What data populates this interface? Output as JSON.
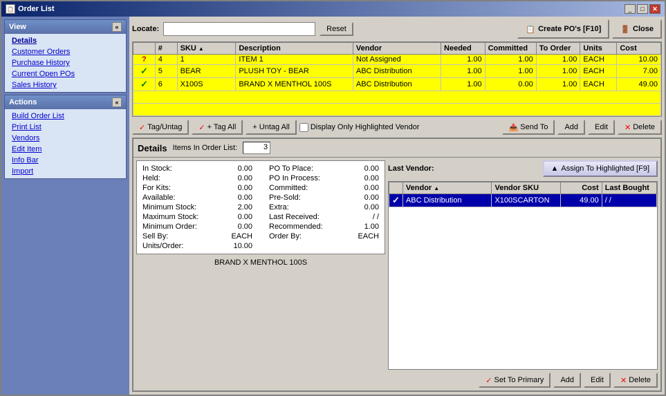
{
  "window": {
    "title": "Order List"
  },
  "locate": {
    "label": "Locate:",
    "placeholder": "",
    "reset_btn": "Reset"
  },
  "toolbar": {
    "create_po_btn": "Create PO's [F10]",
    "close_btn": "Close"
  },
  "table": {
    "columns": [
      "#",
      "SKU",
      "Description",
      "Vendor",
      "Needed",
      "Committed",
      "To Order",
      "Units",
      "Cost"
    ],
    "rows": [
      {
        "check": "?",
        "num": "4",
        "sku": "1",
        "description": "ITEM 1",
        "vendor": "Not Assigned",
        "needed": "1.00",
        "committed": "1.00",
        "to_order": "1.00",
        "units": "EACH",
        "cost": "10.00",
        "selected": false
      },
      {
        "check": "✓",
        "num": "5",
        "sku": "BEAR",
        "description": "PLUSH TOY - BEAR",
        "vendor": "ABC Distribution",
        "needed": "1.00",
        "committed": "1.00",
        "to_order": "1.00",
        "units": "EACH",
        "cost": "7.00",
        "selected": false
      },
      {
        "check": "✓",
        "num": "6",
        "sku": "X100S",
        "description": "BRAND X MENTHOL 100S",
        "vendor": "ABC Distribution",
        "needed": "1.00",
        "committed": "0.00",
        "to_order": "1.00",
        "units": "EACH",
        "cost": "49.00",
        "selected": true
      }
    ]
  },
  "btn_row": {
    "tag_untag": "Tag/Untag",
    "tag_all": "+ Tag All",
    "untag_all": "+ Untag All",
    "display_only_label": "Display Only Highlighted Vendor",
    "send_to": "Send To",
    "add": "Add",
    "edit": "Edit",
    "delete": "Delete"
  },
  "details": {
    "title": "Details",
    "items_label": "Items In Order List:",
    "items_count": "3",
    "last_vendor_label": "Last Vendor:",
    "assign_btn": "Assign To Highlighted [F9]",
    "description_text": "BRAND X MENTHOL 100S"
  },
  "stats": {
    "in_stock_label": "In Stock:",
    "in_stock_value": "0.00",
    "held_label": "Held:",
    "held_value": "0.00",
    "for_kits_label": "For Kits:",
    "for_kits_value": "0.00",
    "available_label": "Available:",
    "available_value": "0.00",
    "min_stock_label": "Minimum Stock:",
    "min_stock_value": "2.00",
    "max_stock_label": "Maximum Stock:",
    "max_stock_value": "0.00",
    "min_order_label": "Minimum Order:",
    "min_order_value": "0.00",
    "sell_by_label": "Sell By:",
    "sell_by_value": "EACH",
    "units_order_label": "Units/Order:",
    "units_order_value": "10.00",
    "po_to_place_label": "PO To Place:",
    "po_to_place_value": "0.00",
    "po_in_process_label": "PO In Process:",
    "po_in_process_value": "0.00",
    "committed_label": "Committed:",
    "committed_value": "0.00",
    "pre_sold_label": "Pre-Sold:",
    "pre_sold_value": "0.00",
    "extra_label": "Extra:",
    "extra_value": "0.00",
    "last_received_label": "Last Received:",
    "last_received_value": "/ /",
    "recommended_label": "Recommended:",
    "recommended_value": "1.00",
    "order_by_label": "Order By:",
    "order_by_value": "EACH"
  },
  "vendor_table": {
    "columns": [
      "Vendor",
      "Vendor SKU",
      "Cost",
      "Last Bought"
    ],
    "rows": [
      {
        "check": "✓",
        "vendor": "ABC Distribution",
        "sku": "X100SCARTON",
        "cost": "49.00",
        "last_bought": "/ /",
        "selected": true
      }
    ]
  },
  "vendor_btns": {
    "set_primary": "Set To Primary",
    "add": "Add",
    "edit": "Edit",
    "delete": "Delete"
  },
  "sidebar": {
    "view_label": "View",
    "view_items": [
      {
        "label": "Details",
        "bold": true
      },
      {
        "label": "Customer Orders",
        "bold": false
      },
      {
        "label": "Purchase History",
        "bold": false
      },
      {
        "label": "Current Open POs",
        "bold": false
      },
      {
        "label": "Sales History",
        "bold": false
      }
    ],
    "actions_label": "Actions",
    "action_items": [
      {
        "label": "Build Order List"
      },
      {
        "label": "Print List"
      },
      {
        "label": "Vendors"
      },
      {
        "label": "Edit Item"
      },
      {
        "label": "Info Bar"
      },
      {
        "label": "Import"
      }
    ]
  }
}
